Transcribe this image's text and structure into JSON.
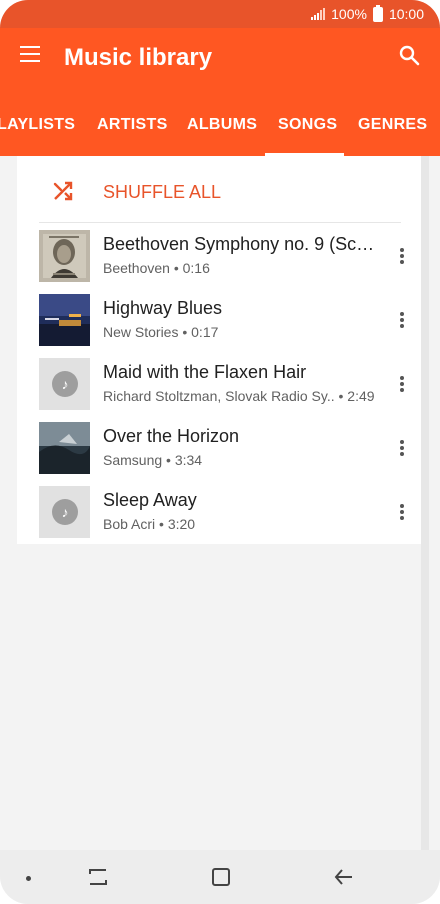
{
  "status_bar": {
    "battery_text": "100%",
    "time": "10:00"
  },
  "app_bar": {
    "title": "Music library"
  },
  "tabs": [
    {
      "label": "LAYLISTS"
    },
    {
      "label": "ARTISTS"
    },
    {
      "label": "ALBUMS"
    },
    {
      "label": "SONGS",
      "selected": true
    },
    {
      "label": "GENRES"
    }
  ],
  "shuffle": {
    "label": "SHUFFLE ALL"
  },
  "songs": [
    {
      "title": "Beethoven Symphony no. 9 (Sch...",
      "artist": "Beethoven",
      "duration": "• 0:16"
    },
    {
      "title": "Highway Blues",
      "artist": "New Stories",
      "duration": "• 0:17"
    },
    {
      "title": "Maid with the Flaxen Hair",
      "artist": "Richard Stoltzman, Slovak Radio Sy..",
      "duration": "• 2:49"
    },
    {
      "title": "Over the Horizon",
      "artist": "Samsung",
      "duration": "• 3:34"
    },
    {
      "title": "Sleep Away",
      "artist": "Bob Acri",
      "duration": "• 3:20"
    }
  ],
  "icons": {
    "menu": "menu-icon",
    "search": "search-icon",
    "shuffle": "shuffle-icon",
    "more": "more-vert-icon",
    "music_note": "music-note-icon"
  },
  "colors": {
    "accent": "#ff5722",
    "status_bar": "#e8542a",
    "shuffle_text": "#e8542a"
  }
}
